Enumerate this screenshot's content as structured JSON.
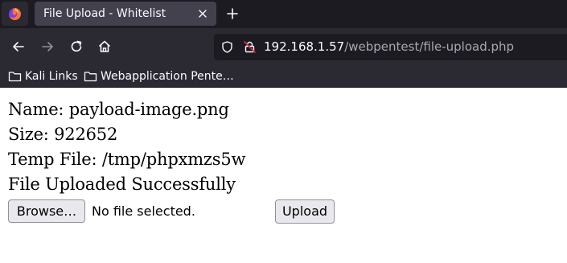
{
  "browser": {
    "tab": {
      "title": "File Upload - Whitelist"
    },
    "url": {
      "host": "192.168.1.57",
      "path": "/webpentest/file-upload.php"
    },
    "bookmarks": [
      {
        "label": "Kali Links"
      },
      {
        "label": "Webapplication Pente…"
      }
    ],
    "colors": {
      "tabstrip": "#1c1b22",
      "toolbar": "#2b2a33",
      "active_tab": "#42414d",
      "urlbar": "#1c1b22",
      "icon": "#fbfbfe",
      "insecure_slash": "#e22850"
    },
    "icons": [
      "firefox-logo-icon",
      "close-icon",
      "plus-icon",
      "back-arrow-icon",
      "forward-arrow-icon",
      "reload-icon",
      "home-icon",
      "shield-icon",
      "insecure-lock-icon",
      "folder-icon"
    ]
  },
  "page": {
    "name_line": "Name: payload-image.png",
    "size_line": "Size: 922652",
    "temp_line": "Temp File: /tmp/phpxmzs5w",
    "status_line": "File Uploaded Successfully",
    "form": {
      "browse_label": "Browse…",
      "file_status": "No file selected.",
      "upload_label": "Upload"
    }
  }
}
